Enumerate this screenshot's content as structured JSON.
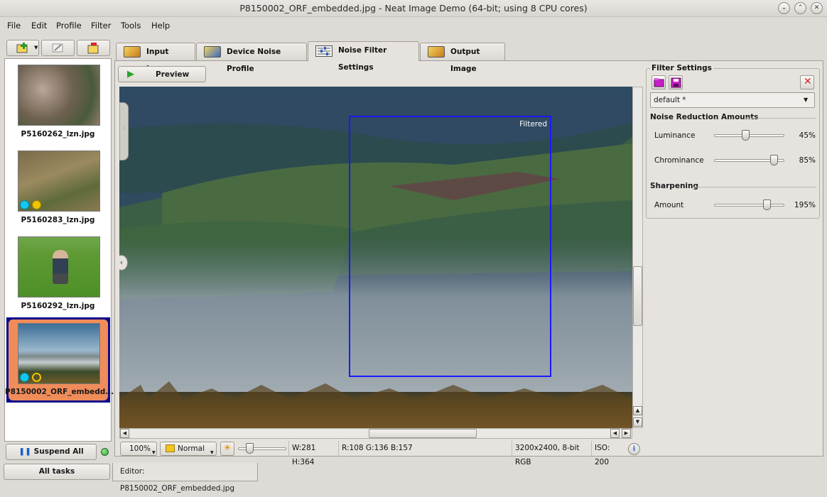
{
  "window": {
    "title": "P8150002_ORF_embedded.jpg - Neat Image Demo (64-bit; using 8 CPU cores)",
    "controls": [
      "minimize-icon",
      "maximize-icon",
      "close-icon"
    ]
  },
  "menu": [
    {
      "label": "File"
    },
    {
      "label": "Edit"
    },
    {
      "label": "Profile"
    },
    {
      "label": "Filter"
    },
    {
      "label": "Tools"
    },
    {
      "label": "Help"
    }
  ],
  "batch": {
    "toolbar_icons": [
      "add-image-icon",
      "edit-icon",
      "remove-image-icon"
    ],
    "items": [
      {
        "filename": "P5160262_lzn.jpg",
        "badges": []
      },
      {
        "filename": "P5160283_lzn.jpg",
        "badges": [
          "cyan-dot",
          "yellow-dot"
        ]
      },
      {
        "filename": "P5160292_lzn.jpg",
        "badges": []
      },
      {
        "filename": "P8150002_ORF_embedd...",
        "badges": [
          "cyan-dot",
          "yellow-ring"
        ],
        "selected": true
      }
    ],
    "suspend_label": "Suspend All",
    "all_tasks_label": "All tasks"
  },
  "tabs": [
    {
      "label": "Input Image"
    },
    {
      "label": "Device Noise Profile"
    },
    {
      "label": "Noise Filter Settings",
      "active": true
    },
    {
      "label": "Output Image"
    }
  ],
  "editor_tab": "Editor: P8150002_ORF_embedded.jpg",
  "preview": {
    "button_label": "Preview",
    "filtered_label": "Filtered"
  },
  "status": {
    "zoom": "100%",
    "mode": "Normal",
    "size_readout": "W:281 H:364",
    "color_readout": "R:108 G:136 B:157",
    "image_info": "3200x2400, 8-bit RGB",
    "iso": "ISO: 200"
  },
  "filter_settings": {
    "group_title": "Filter Settings",
    "preset": "default *",
    "noise_reduction_title": "Noise Reduction Amounts",
    "sharpening_title": "Sharpening",
    "sliders": {
      "luminance": {
        "label": "Luminance",
        "value_text": "45%",
        "fraction": 0.45
      },
      "chrominance": {
        "label": "Chrominance",
        "value_text": "85%",
        "fraction": 0.85
      },
      "amount": {
        "label": "Amount",
        "value_text": "195%",
        "fraction": 0.75
      }
    }
  },
  "colors": {
    "selection_highlight": "#f08c5a",
    "selection_border": "#0a0a8c",
    "preview_box": "#1a1aff",
    "status_led": "#2ea82e"
  }
}
